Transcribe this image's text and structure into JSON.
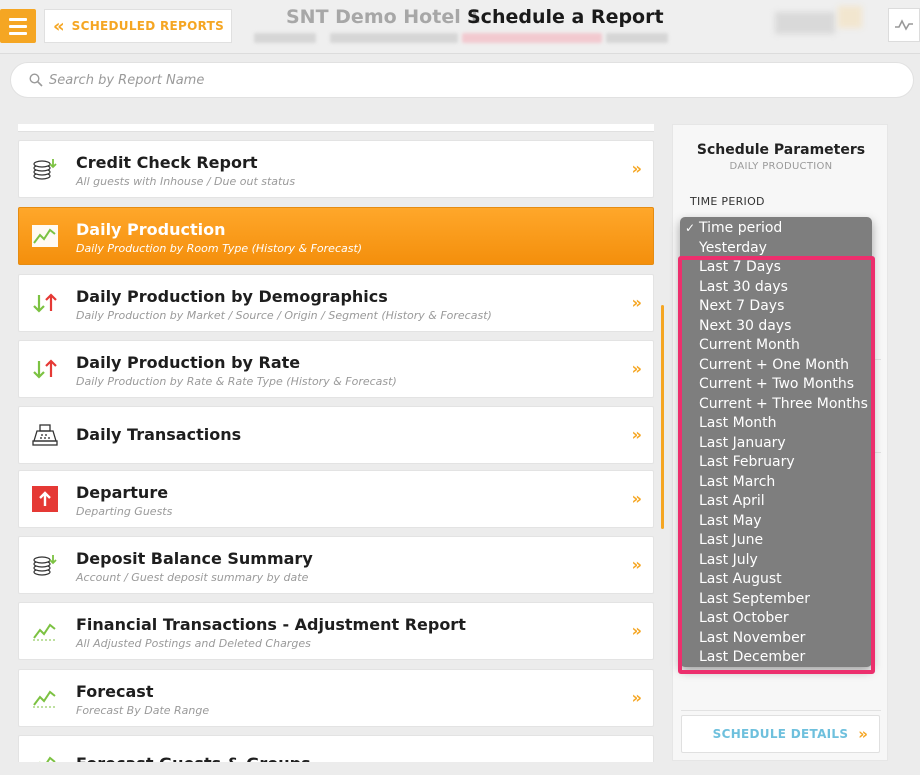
{
  "header": {
    "back_label": "SCHEDULED REPORTS",
    "hotel_name": "SNT Demo Hotel 1",
    "page_title": "Schedule a Report"
  },
  "search": {
    "placeholder": "Search by Report Name"
  },
  "reports": [
    {
      "title": "Credit Check Report",
      "subtitle": "All guests with Inhouse / Due out status",
      "icon": "coins-stack-icon",
      "active": false
    },
    {
      "title": "Daily Production",
      "subtitle": "Daily Production by Room Type (History & Forecast)",
      "icon": "trend-chart-icon",
      "active": true
    },
    {
      "title": "Daily Production by Demographics",
      "subtitle": "Daily Production by Market / Source / Origin / Segment (History & Forecast)",
      "icon": "up-down-arrows-icon",
      "active": false
    },
    {
      "title": "Daily Production by Rate",
      "subtitle": "Daily Production by Rate & Rate Type (History & Forecast)",
      "icon": "up-down-arrows-icon",
      "active": false
    },
    {
      "title": "Daily Transactions",
      "subtitle": "",
      "icon": "cash-register-icon",
      "active": false
    },
    {
      "title": "Departure",
      "subtitle": "Departing Guests",
      "icon": "departure-arrow-icon",
      "active": false
    },
    {
      "title": "Deposit Balance Summary",
      "subtitle": "Account / Guest deposit summary by date",
      "icon": "coins-stack-icon",
      "active": false
    },
    {
      "title": "Financial Transactions - Adjustment Report",
      "subtitle": "All Adjusted Postings and Deleted Charges",
      "icon": "trend-chart-icon",
      "active": false
    },
    {
      "title": "Forecast",
      "subtitle": "Forecast By Date Range",
      "icon": "trend-chart-icon",
      "active": false
    },
    {
      "title": "Forecast Guests & Groups",
      "subtitle": "",
      "icon": "trend-chart-icon",
      "active": false
    }
  ],
  "panel": {
    "title": "Schedule Parameters",
    "subtitle": "DAILY PRODUCTION",
    "time_period_label": "TIME PERIOD",
    "schedule_button": "SCHEDULE DETAILS"
  },
  "time_period_options": [
    "Time period",
    "Yesterday",
    "Last 7 Days",
    "Last 30 days",
    "Next 7 Days",
    "Next 30 days",
    "Current Month",
    "Current + One Month",
    "Current + Two Months",
    "Current + Three Months",
    "Last Month",
    "Last January",
    "Last February",
    "Last March",
    "Last April",
    "Last May",
    "Last June",
    "Last July",
    "Last August",
    "Last September",
    "Last October",
    "Last November",
    "Last December"
  ],
  "time_period_selected": "Time period",
  "colors": {
    "accent": "#f5a623",
    "highlight": "#ec2f6d",
    "link": "#6ec0dd"
  }
}
